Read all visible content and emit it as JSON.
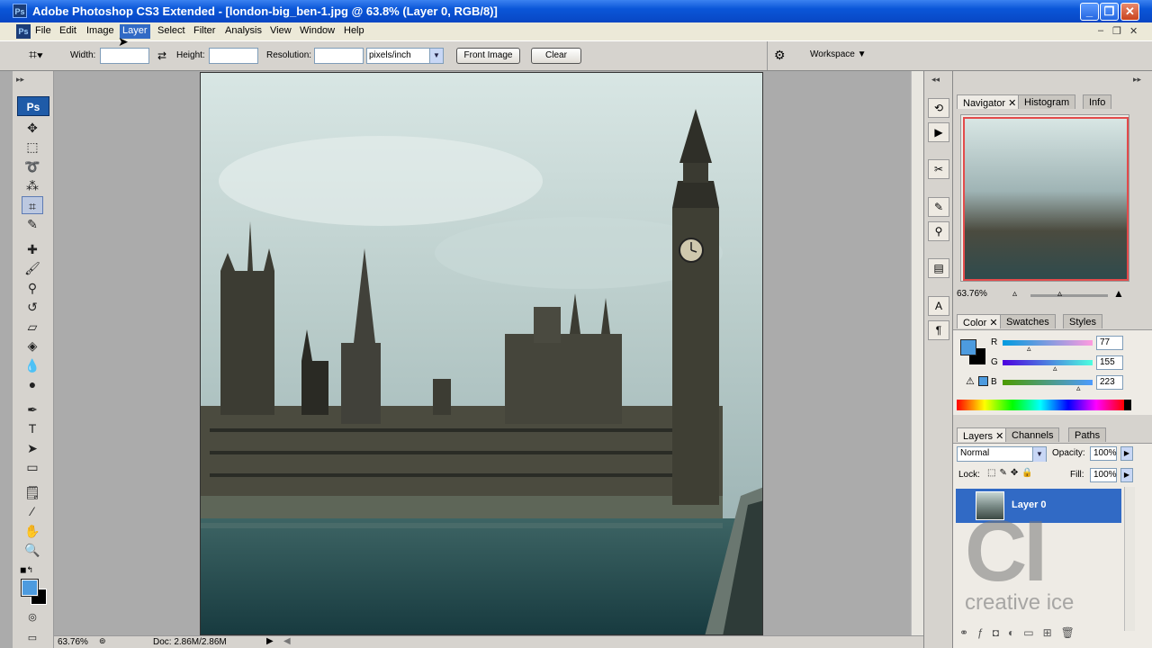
{
  "window": {
    "title": "Adobe Photoshop CS3 Extended - [london-big_ben-1.jpg @ 63.8% (Layer 0, RGB/8)]",
    "app_icon": "Ps"
  },
  "menu": [
    "File",
    "Edit",
    "Image",
    "Layer",
    "Select",
    "Filter",
    "Analysis",
    "View",
    "Window",
    "Help"
  ],
  "options": {
    "width_label": "Width:",
    "width_value": "",
    "height_label": "Height:",
    "height_value": "",
    "resolution_label": "Resolution:",
    "resolution_value": "",
    "resolution_unit": "pixels/inch",
    "front_image": "Front Image",
    "clear": "Clear",
    "workspace": "Workspace"
  },
  "toolbox": {
    "logo": "Ps"
  },
  "status": {
    "zoom": "63.76%",
    "doc": "Doc: 2.86M/2.86M"
  },
  "navigator": {
    "tabs": [
      "Navigator",
      "Histogram",
      "Info"
    ],
    "zoom": "63.76%"
  },
  "color": {
    "tabs": [
      "Color",
      "Swatches",
      "Styles"
    ],
    "r_label": "R",
    "r": "77",
    "g_label": "G",
    "g": "155",
    "b_label": "B",
    "b": "223",
    "foreground": "#4d9bdf"
  },
  "layers": {
    "tabs": [
      "Layers",
      "Channels",
      "Paths"
    ],
    "blend_mode": "Normal",
    "opacity_label": "Opacity:",
    "opacity": "100%",
    "lock_label": "Lock:",
    "fill_label": "Fill:",
    "fill": "100%",
    "layer_name": "Layer 0"
  },
  "watermark": {
    "logo_letters": "CI",
    "brand": "creative ice"
  }
}
